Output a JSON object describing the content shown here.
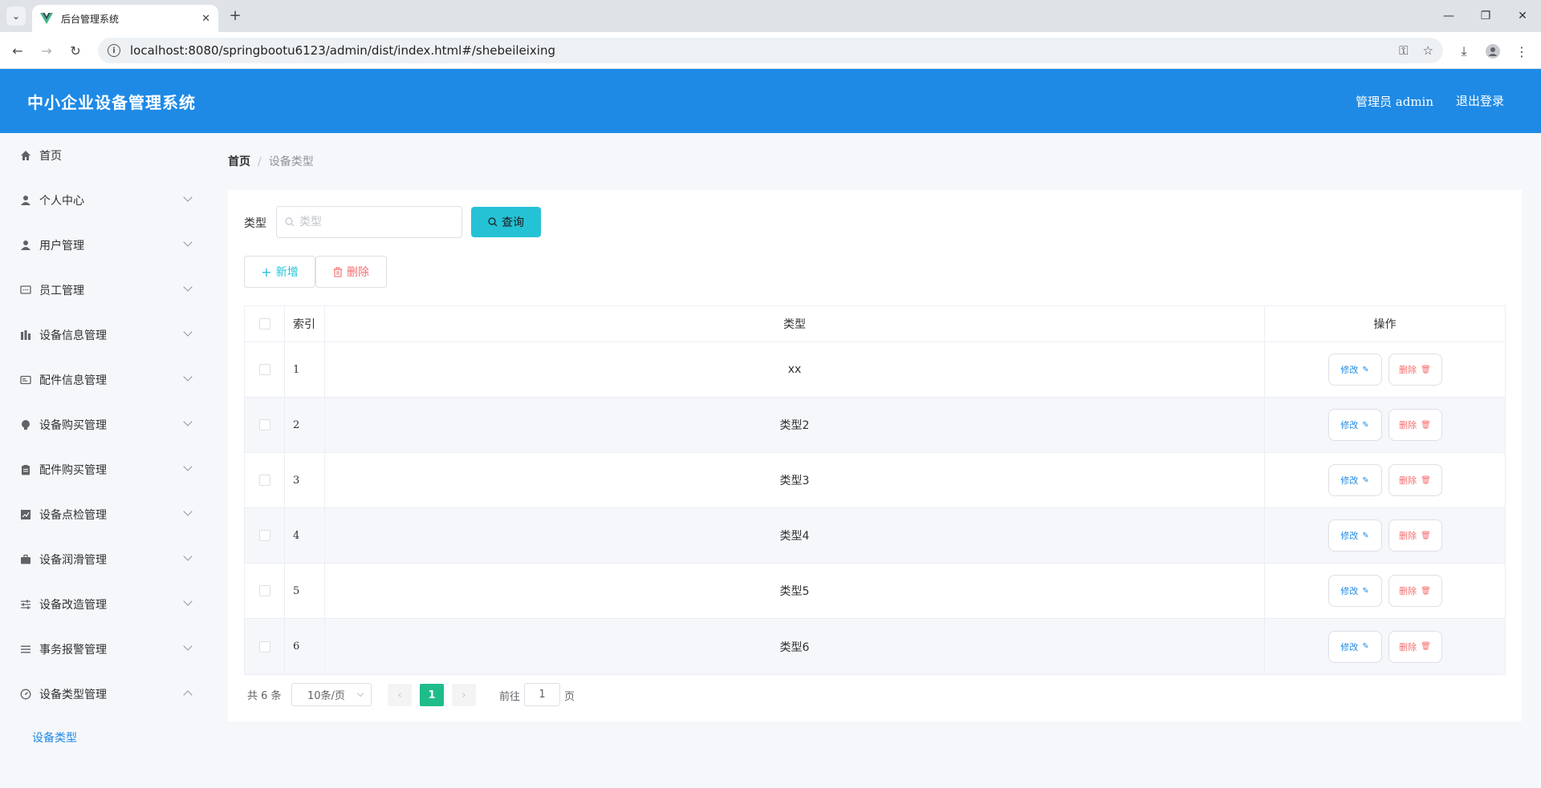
{
  "browser": {
    "tab_title": "后台管理系统",
    "url": "localhost:8080/springbootu6123/admin/dist/index.html#/shebeileixing"
  },
  "header": {
    "app_title": "中小企业设备管理系统",
    "user": "管理员 admin",
    "logout": "退出登录",
    "color": "#1e8ae6"
  },
  "sidebar": {
    "items": [
      {
        "label": "首页",
        "icon": "home-icon",
        "expandable": false
      },
      {
        "label": "个人中心",
        "icon": "user-icon",
        "expandable": true
      },
      {
        "label": "用户管理",
        "icon": "user-icon",
        "expandable": true
      },
      {
        "label": "员工管理",
        "icon": "chat-icon",
        "expandable": true
      },
      {
        "label": "设备信息管理",
        "icon": "bar-chart-icon",
        "expandable": true
      },
      {
        "label": "配件信息管理",
        "icon": "id-card-icon",
        "expandable": true
      },
      {
        "label": "设备购买管理",
        "icon": "bulb-icon",
        "expandable": true
      },
      {
        "label": "配件购买管理",
        "icon": "clipboard-icon",
        "expandable": true
      },
      {
        "label": "设备点检管理",
        "icon": "line-chart-icon",
        "expandable": true
      },
      {
        "label": "设备润滑管理",
        "icon": "briefcase-icon",
        "expandable": true
      },
      {
        "label": "设备改造管理",
        "icon": "sliders-icon",
        "expandable": true
      },
      {
        "label": "事务报警管理",
        "icon": "list-icon",
        "expandable": true
      },
      {
        "label": "设备类型管理",
        "icon": "gauge-icon",
        "expandable": true,
        "expanded": true
      }
    ],
    "submenu_active": "设备类型"
  },
  "breadcrumb": {
    "home": "首页",
    "separator": "/",
    "current": "设备类型"
  },
  "search": {
    "label": "类型",
    "placeholder": "类型",
    "value": "",
    "button": "查询"
  },
  "actions": {
    "add": "新增",
    "delete": "删除"
  },
  "table": {
    "columns": [
      "索引",
      "类型",
      "操作"
    ],
    "rows": [
      {
        "index": "1",
        "type": "xx"
      },
      {
        "index": "2",
        "type": "类型2"
      },
      {
        "index": "3",
        "type": "类型3"
      },
      {
        "index": "4",
        "type": "类型4"
      },
      {
        "index": "5",
        "type": "类型5"
      },
      {
        "index": "6",
        "type": "类型6"
      }
    ],
    "edit_label": "修改",
    "delete_label": "删除"
  },
  "pagination": {
    "total": "共 6 条",
    "page_size": "10条/页",
    "current_page": "1",
    "goto_label": "前往",
    "goto_value": "1",
    "goto_suffix": "页"
  },
  "colors": {
    "accent": "#25c2d6",
    "danger": "#f56c6c",
    "page_active": "#1fbc8b"
  }
}
